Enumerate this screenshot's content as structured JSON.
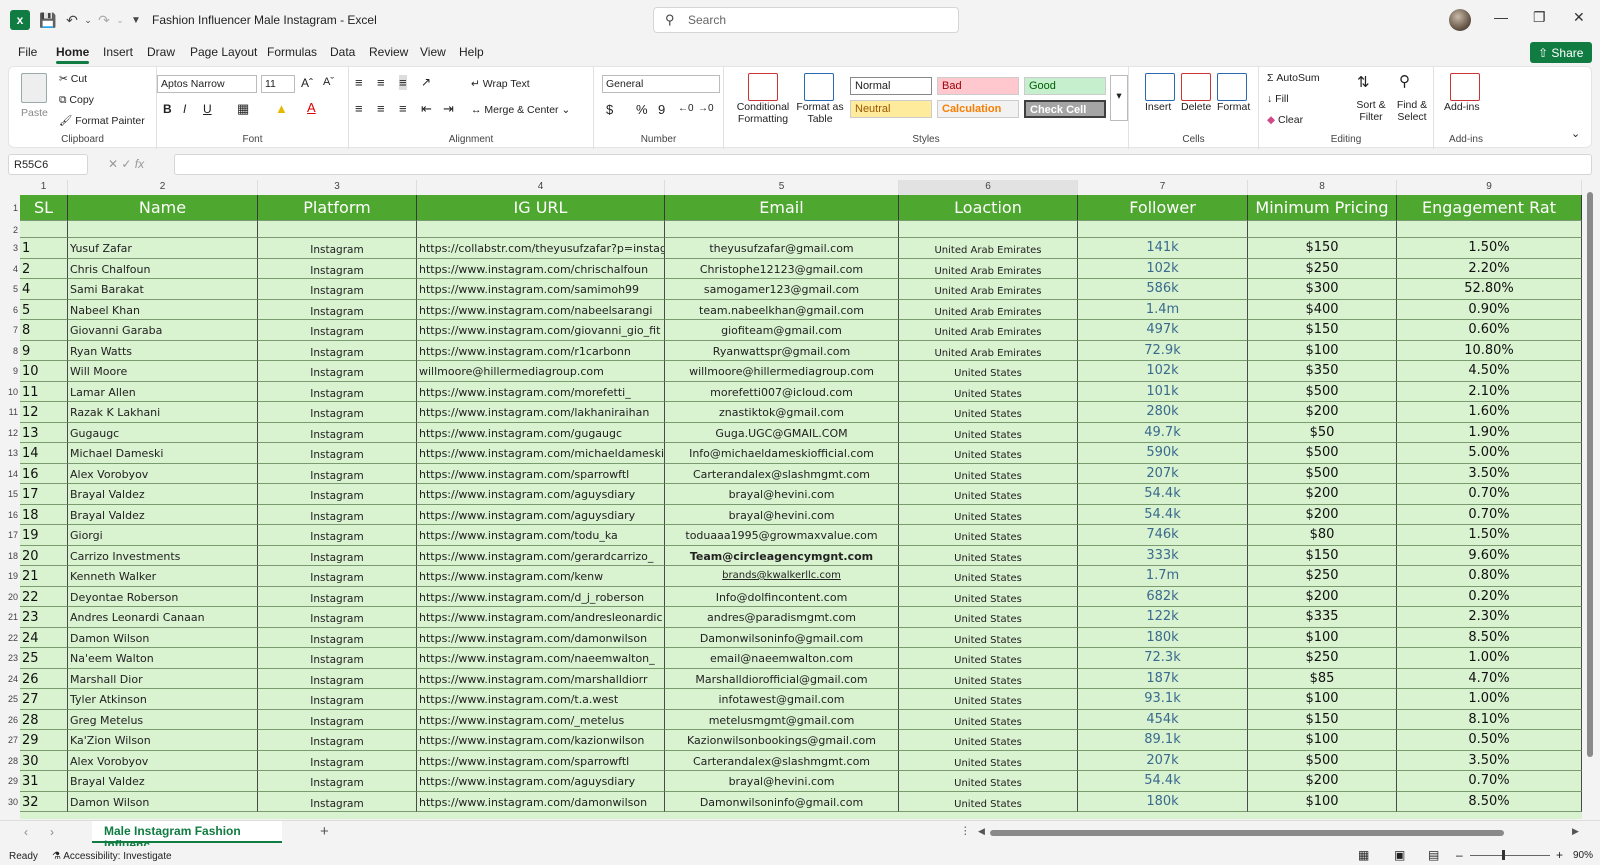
{
  "app": {
    "title": "Fashion Influencer Male Instagram  -  Excel",
    "search_placeholder": "Search",
    "share_label": "Share"
  },
  "menu": [
    "File",
    "Home",
    "Insert",
    "Draw",
    "Page Layout",
    "Formulas",
    "Data",
    "Review",
    "View",
    "Help"
  ],
  "ribbon": {
    "clipboard": {
      "paste": "Paste",
      "cut": "Cut",
      "copy": "Copy",
      "format_painter": "Format Painter",
      "label": "Clipboard"
    },
    "font": {
      "name": "Aptos Narrow",
      "size": "11",
      "label": "Font",
      "bold": "B",
      "italic": "I",
      "underline": "U"
    },
    "alignment": {
      "wrap": "Wrap Text",
      "merge": "Merge & Center",
      "label": "Alignment"
    },
    "number": {
      "format": "General",
      "currency": "$",
      "percent": "%",
      "comma": "9",
      "label": "Number"
    },
    "styles": {
      "conditional": "Conditional Formatting",
      "format_table": "Format as Table",
      "normal": "Normal",
      "bad": "Bad",
      "good": "Good",
      "neutral": "Neutral",
      "calculation": "Calculation",
      "check": "Check Cell",
      "label": "Styles"
    },
    "cells": {
      "insert": "Insert",
      "delete": "Delete",
      "format": "Format",
      "label": "Cells"
    },
    "editing": {
      "autosum": "AutoSum",
      "fill": "Fill",
      "clear": "Clear",
      "sort": "Sort & Filter",
      "find": "Find & Select",
      "label": "Editing"
    },
    "addins": {
      "addins": "Add-ins",
      "label": "Add-ins"
    }
  },
  "formula_bar": {
    "name_box": "R55C6",
    "fx": "fx",
    "value": ""
  },
  "columns": [
    "1",
    "2",
    "3",
    "4",
    "5",
    "6",
    "7",
    "8",
    "9"
  ],
  "headers": [
    "SL",
    "Name",
    "Platform",
    "IG URL",
    "Email",
    "Loaction",
    "Follower",
    "Minimum Pricing",
    "Engagement Rat"
  ],
  "row_numbers": [
    "1",
    "2",
    "3",
    "4",
    "5",
    "6",
    "7",
    "8",
    "9",
    "10",
    "11",
    "12",
    "13",
    "14",
    "15",
    "16",
    "17",
    "18",
    "19",
    "20",
    "21",
    "22",
    "23",
    "24",
    "25",
    "26",
    "27",
    "28",
    "29",
    "30"
  ],
  "rows": [
    [
      "1",
      "Yusuf Zafar",
      "Instagram",
      "https://collabstr.com/theyusufzafar?p=instagram",
      "theyusufzafar@gmail.com",
      "United Arab Emirates",
      "141k",
      "$150",
      "1.50%"
    ],
    [
      "2",
      "Chris Chalfoun",
      "Instagram",
      "https://www.instagram.com/chrischalfoun",
      "Christophe12123@gmail.com",
      "United Arab Emirates",
      "102k",
      "$250",
      "2.20%"
    ],
    [
      "4",
      "Sami Barakat",
      "Instagram",
      "https://www.instagram.com/samimoh99",
      "samogamer123@gmail.com",
      "United Arab Emirates",
      "586k",
      "$300",
      "52.80%"
    ],
    [
      "5",
      "Nabeel Khan",
      "Instagram",
      "https://www.instagram.com/nabeelsarangi",
      "team.nabeelkhan@gmail.com",
      "United Arab Emirates",
      "1.4m",
      "$400",
      "0.90%"
    ],
    [
      "8",
      "Giovanni Garaba",
      "Instagram",
      "https://www.instagram.com/giovanni_gio_fit",
      "giofiteam@gmail.com",
      "United Arab Emirates",
      "497k",
      "$150",
      "0.60%"
    ],
    [
      "9",
      "Ryan Watts",
      "Instagram",
      "https://www.instagram.com/r1carbonn",
      "Ryanwattspr@gmail.com",
      "United Arab Emirates",
      "72.9k",
      "$100",
      "10.80%"
    ],
    [
      "10",
      "Will Moore",
      "Instagram",
      "willmoore@hillermediagroup.com",
      "willmoore@hillermediagroup.com",
      "United States",
      "102k",
      "$350",
      "4.50%"
    ],
    [
      "11",
      "Lamar Allen",
      "Instagram",
      "https://www.instagram.com/morefetti_",
      "morefetti007@icloud.com",
      "United States",
      "101k",
      "$500",
      "2.10%"
    ],
    [
      "12",
      "Razak K Lakhani",
      "Instagram",
      "https://www.instagram.com/lakhaniraihan",
      "znastiktok@gmail.com",
      "United States",
      "280k",
      "$200",
      "1.60%"
    ],
    [
      "13",
      "Gugaugc",
      "Instagram",
      "https://www.instagram.com/gugaugc",
      "Guga.UGC@GMAIL.COM",
      "United States",
      "49.7k",
      "$50",
      "1.90%"
    ],
    [
      "14",
      "Michael Dameski",
      "Instagram",
      "https://www.instagram.com/michaeldameski",
      "Info@michaeldameskiofficial.com",
      "United States",
      "590k",
      "$500",
      "5.00%"
    ],
    [
      "16",
      "Alex Vorobyov",
      "Instagram",
      "https://www.instagram.com/sparrowftl",
      "Carterandalex@slashmgmt.com",
      "United States",
      "207k",
      "$500",
      "3.50%"
    ],
    [
      "17",
      "Brayal Valdez",
      "Instagram",
      "https://www.instagram.com/aguysdiary",
      "brayal@hevini.com",
      "United States",
      "54.4k",
      "$200",
      "0.70%"
    ],
    [
      "18",
      "Brayal Valdez",
      "Instagram",
      "https://www.instagram.com/aguysdiary",
      "brayal@hevini.com",
      "United States",
      "54.4k",
      "$200",
      "0.70%"
    ],
    [
      "19",
      "Giorgi",
      "Instagram",
      "https://www.instagram.com/todu_ka",
      "toduaaa1995@growmaxvalue.com",
      "United States",
      "746k",
      "$80",
      "1.50%"
    ],
    [
      "20",
      "Carrizo Investments",
      "Instagram",
      "https://www.instagram.com/gerardcarrizo_",
      "Team@circleagencymgnt.com",
      "United States",
      "333k",
      "$150",
      "9.60%"
    ],
    [
      "21",
      "Kenneth Walker",
      "Instagram",
      "https://www.instagram.com/kenw",
      "brands@kwalkerllc.com",
      "United States",
      "1.7m",
      "$250",
      "0.80%"
    ],
    [
      "22",
      "Deyontae Roberson",
      "Instagram",
      "https://www.instagram.com/d_j_roberson",
      "Info@dolfincontent.com",
      "United States",
      "682k",
      "$200",
      "0.20%"
    ],
    [
      "23",
      "Andres Leonardi Canaan",
      "Instagram",
      "https://www.instagram.com/andresleonardic",
      "andres@paradismgmt.com",
      "United States",
      "122k",
      "$335",
      "2.30%"
    ],
    [
      "24",
      "Damon Wilson",
      "Instagram",
      "https://www.instagram.com/damonwilson",
      "Damonwilsoninfo@gmail.com",
      "United States",
      "180k",
      "$100",
      "8.50%"
    ],
    [
      "25",
      "Na'eem Walton",
      "Instagram",
      "https://www.instagram.com/naeemwalton_",
      "email@naeemwalton.com",
      "United States",
      "72.3k",
      "$250",
      "1.00%"
    ],
    [
      "26",
      "Marshall Dior",
      "Instagram",
      "https://www.instagram.com/marshalldiorr",
      "Marshalldiorofficial@gmail.com",
      "United States",
      "187k",
      "$85",
      "4.70%"
    ],
    [
      "27",
      "Tyler Atkinson",
      "Instagram",
      "https://www.instagram.com/t.a.west",
      "infotawest@gmail.com",
      "United States",
      "93.1k",
      "$100",
      "1.00%"
    ],
    [
      "28",
      "Greg Metelus",
      "Instagram",
      "https://www.instagram.com/_metelus",
      "metelusmgmt@gmail.com",
      "United States",
      "454k",
      "$150",
      "8.10%"
    ],
    [
      "29",
      "Ka'Zion Wilson",
      "Instagram",
      "https://www.instagram.com/kazionwilson",
      "Kazionwilsonbookings@gmail.com",
      "United States",
      "89.1k",
      "$100",
      "0.50%"
    ],
    [
      "30",
      "Alex Vorobyov",
      "Instagram",
      "https://www.instagram.com/sparrowftl",
      "Carterandalex@slashmgmt.com",
      "United States",
      "207k",
      "$500",
      "3.50%"
    ],
    [
      "31",
      "Brayal Valdez",
      "Instagram",
      "https://www.instagram.com/aguysdiary",
      "brayal@hevini.com",
      "United States",
      "54.4k",
      "$200",
      "0.70%"
    ],
    [
      "32",
      "Damon Wilson",
      "Instagram",
      "https://www.instagram.com/damonwilson",
      "Damonwilsoninfo@gmail.com",
      "United States",
      "180k",
      "$100",
      "8.50%"
    ]
  ],
  "sheet_tab": "Male Instagram Fashion Influenc",
  "status": {
    "ready": "Ready",
    "accessibility": "Accessibility: Investigate",
    "zoom": "90%"
  },
  "colors": {
    "header_green": "#4ea72e",
    "row_green": "#d9f2d0",
    "excel_green": "#107c41",
    "follower_blue": "#3a6b8f"
  }
}
